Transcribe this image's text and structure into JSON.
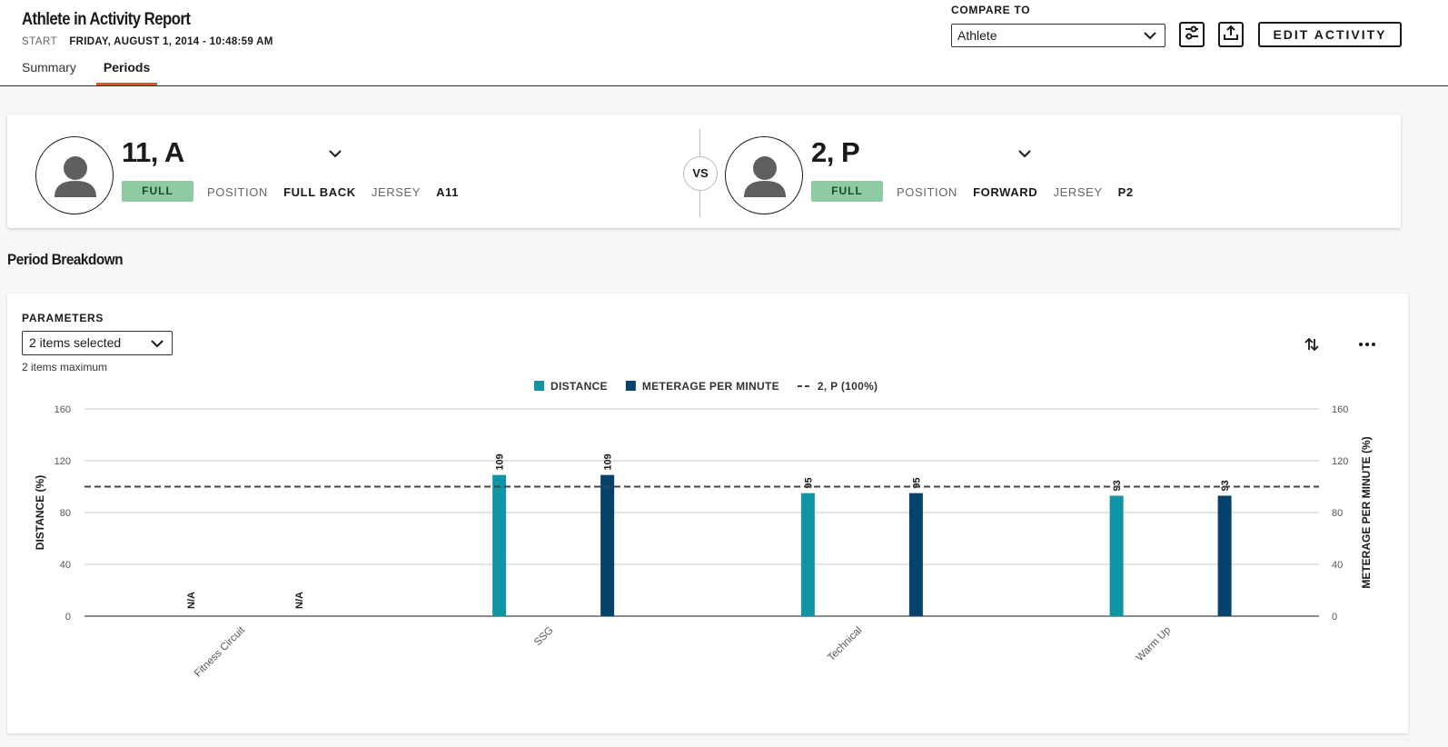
{
  "header": {
    "title": "Athlete in Activity Report",
    "start_label": "START",
    "start_value": "FRIDAY, AUGUST 1, 2014 - 10:48:59 AM",
    "tabs": [
      {
        "label": "Summary",
        "active": false
      },
      {
        "label": "Periods",
        "active": true
      }
    ],
    "compare_label": "COMPARE TO",
    "compare_value": "Athlete",
    "edit_label": "EDIT ACTIVITY",
    "icons": [
      "sliders-icon",
      "export-icon",
      "chevron-down-icon"
    ]
  },
  "athletes": [
    {
      "name": "11, A",
      "status": "FULL",
      "position_label": "POSITION",
      "position": "FULL BACK",
      "jersey_label": "JERSEY",
      "jersey": "A11"
    },
    {
      "name": "2, P",
      "status": "FULL",
      "position_label": "POSITION",
      "position": "FORWARD",
      "jersey_label": "JERSEY",
      "jersey": "P2"
    }
  ],
  "vs_label": "VS",
  "section_title": "Period Breakdown",
  "parameters": {
    "label": "PARAMETERS",
    "selected": "2 items selected",
    "hint": "2 items maximum"
  },
  "colors": {
    "distance": "#0f95a3",
    "meterage": "#06426b",
    "status_badge": "#8fcba2",
    "tab_accent": "#e6502d"
  },
  "chart_data": {
    "type": "bar",
    "categories": [
      "Fitness Circuit",
      "SSG",
      "Technical",
      "Warm Up"
    ],
    "series": [
      {
        "name": "DISTANCE",
        "values": [
          null,
          109,
          95,
          93
        ],
        "labels": [
          "N/A",
          "109",
          "95",
          "93"
        ],
        "color": "#0f95a3",
        "axis": "left"
      },
      {
        "name": "METERAGE PER MINUTE",
        "values": [
          null,
          109,
          95,
          93
        ],
        "labels": [
          "N/A",
          "109",
          "95",
          "93"
        ],
        "color": "#06426b",
        "axis": "right"
      }
    ],
    "reference_line": {
      "name": "2, P (100%)",
      "value": 100,
      "style": "dashed"
    },
    "ylabel": "DISTANCE (%)",
    "y2label": "METERAGE PER MINUTE (%)",
    "ylim": [
      0,
      160
    ],
    "yticks": [
      0,
      40,
      80,
      120,
      160
    ],
    "grid": true,
    "legend_position": "top-center"
  }
}
